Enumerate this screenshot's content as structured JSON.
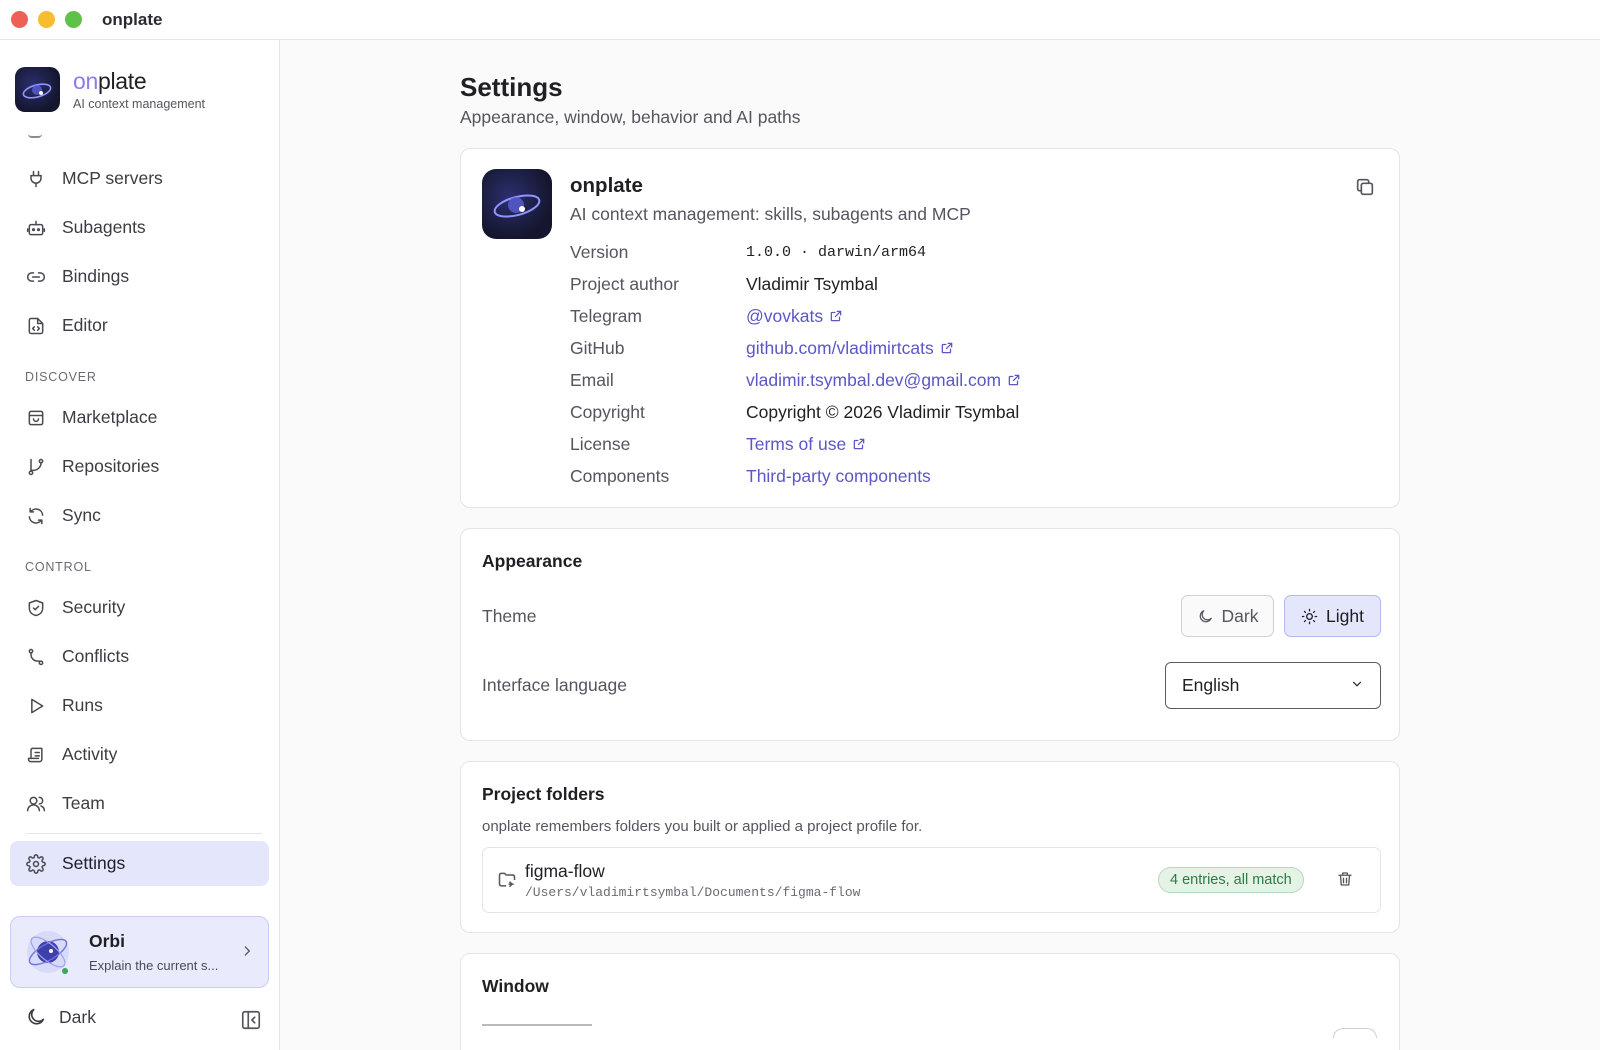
{
  "window": {
    "title": "onplate"
  },
  "brand": {
    "name_on": "on",
    "name_plate": "plate",
    "subtitle": "AI context management"
  },
  "sidebar": {
    "items_top": [
      {
        "label": "MCP servers",
        "icon": "plug-icon"
      },
      {
        "label": "Subagents",
        "icon": "robot-icon"
      },
      {
        "label": "Bindings",
        "icon": "link-icon"
      },
      {
        "label": "Editor",
        "icon": "file-code-icon"
      }
    ],
    "section_discover": "DISCOVER",
    "items_discover": [
      {
        "label": "Marketplace",
        "icon": "store-icon"
      },
      {
        "label": "Repositories",
        "icon": "git-branch-icon"
      },
      {
        "label": "Sync",
        "icon": "refresh-icon"
      }
    ],
    "section_control": "CONTROL",
    "items_control": [
      {
        "label": "Security",
        "icon": "shield-check-icon"
      },
      {
        "label": "Conflicts",
        "icon": "git-merge-icon"
      },
      {
        "label": "Runs",
        "icon": "play-icon"
      },
      {
        "label": "Activity",
        "icon": "scroll-icon"
      },
      {
        "label": "Team",
        "icon": "users-icon"
      }
    ],
    "settings_label": "Settings",
    "orbi": {
      "name": "Orbi",
      "subtitle": "Explain the current s..."
    },
    "theme_toggle_label": "Dark"
  },
  "page": {
    "title": "Settings",
    "subtitle": "Appearance, window, behavior and AI paths"
  },
  "about": {
    "name": "onplate",
    "description": "AI context management: skills, subagents and MCP",
    "rows": {
      "version": {
        "label": "Version",
        "value": "1.0.0 · darwin/arm64"
      },
      "author": {
        "label": "Project author",
        "value": "Vladimir Tsymbal"
      },
      "telegram": {
        "label": "Telegram",
        "value": "@vovkats"
      },
      "github": {
        "label": "GitHub",
        "value": "github.com/vladimirtcats"
      },
      "email": {
        "label": "Email",
        "value": "vladimir.tsymbal.dev@gmail.com"
      },
      "copyright": {
        "label": "Copyright",
        "value": "Copyright © 2026 Vladimir Tsymbal"
      },
      "license": {
        "label": "License",
        "value": "Terms of use"
      },
      "components": {
        "label": "Components",
        "value": "Third-party components"
      }
    }
  },
  "appearance": {
    "title": "Appearance",
    "theme_label": "Theme",
    "theme_dark": "Dark",
    "theme_light": "Light",
    "theme_selected": "Light",
    "language_label": "Interface language",
    "language_value": "English"
  },
  "folders": {
    "title": "Project folders",
    "description": "onplate remembers folders you built or applied a project profile for.",
    "items": [
      {
        "name": "figma-flow",
        "path": "/Users/vladimirtsymbal/Documents/figma-flow",
        "badge": "4 entries, all match"
      }
    ]
  },
  "window_section": {
    "title": "Window"
  },
  "colors": {
    "accent": "#5b57c7",
    "active_bg": "#e4e6fb",
    "badge_green": "#2f7a42"
  }
}
